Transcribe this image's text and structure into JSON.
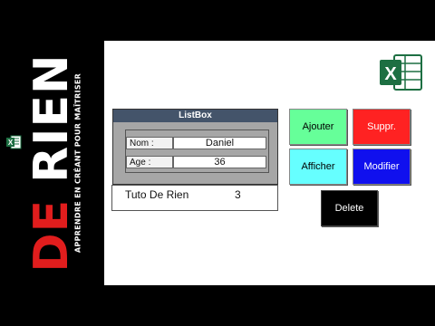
{
  "branding": {
    "word1": "DE",
    "word2": "RIEN",
    "tagline": "APPRENDRE EN CRÉANT POUR MAÎTRISER",
    "mini_logo_letter": "X"
  },
  "excel_logo": {
    "letter": "X"
  },
  "listbox": {
    "title": "ListBox",
    "fields": [
      {
        "label": "Nom :",
        "value": "Daniel"
      },
      {
        "label": "Age :",
        "value": "36"
      }
    ],
    "list_items": [
      {
        "name": "Tuto De Rien",
        "number": "3"
      }
    ]
  },
  "buttons": {
    "ajouter": "Ajouter",
    "suppr": "Suppr.",
    "afficher": "Afficher",
    "modifier": "Modifier",
    "delete": "Delete"
  },
  "colors": {
    "ajouter": "#66ff99",
    "suppr": "#ff2222",
    "afficher": "#66ffff",
    "modifier": "#1010ee",
    "delete": "#000000",
    "listbox_header": "#44546a",
    "brand_red": "#e11d1d",
    "excel_green": "#1d6f42"
  }
}
